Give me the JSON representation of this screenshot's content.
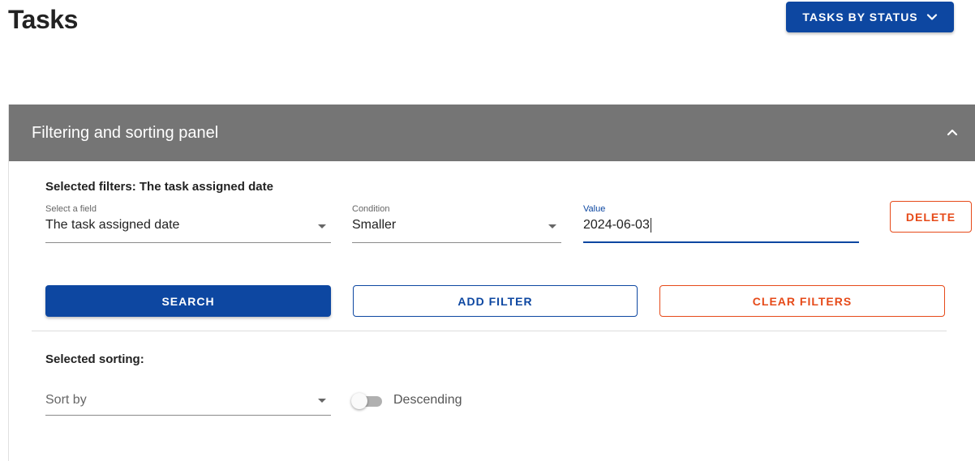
{
  "page": {
    "title": "Tasks",
    "view_button_label": "TASKS BY STATUS"
  },
  "panel": {
    "title": "Filtering and sorting panel",
    "expanded": true
  },
  "filters": {
    "heading": "Selected filters: The task assigned date",
    "rows": [
      {
        "field_label": "Select a field",
        "field_value": "The task assigned date",
        "condition_label": "Condition",
        "condition_value": "Smaller",
        "value_label": "Value",
        "value_value": "2024-06-03",
        "delete_label": "DELETE"
      }
    ],
    "search_label": "SEARCH",
    "add_filter_label": "ADD FILTER",
    "clear_filters_label": "CLEAR FILTERS"
  },
  "sorting": {
    "heading": "Selected sorting:",
    "sort_by_placeholder": "Sort by",
    "descending_label": "Descending",
    "descending_on": false
  },
  "colors": {
    "primary": "#0d47a1",
    "danger": "#e64a19",
    "panel_header": "#757575"
  }
}
